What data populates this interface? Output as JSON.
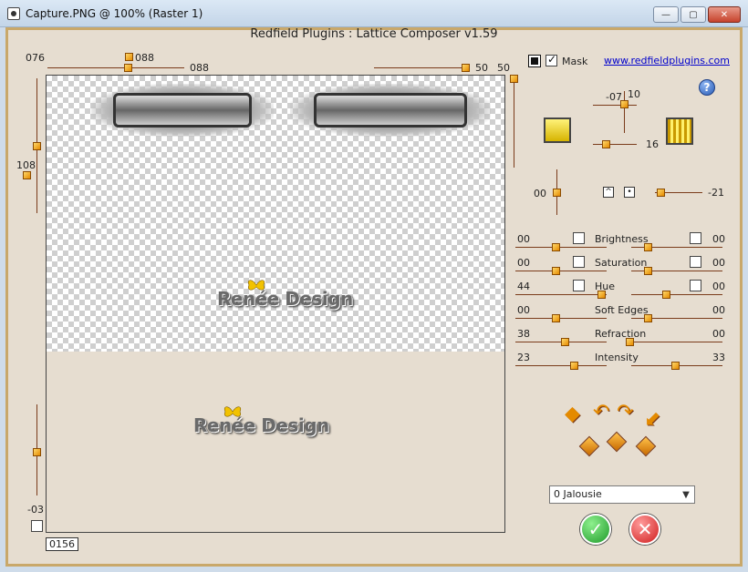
{
  "window": {
    "title": "Capture.PNG @ 100% (Raster 1)"
  },
  "plugin": {
    "title": "Redfield Plugins : Lattice Composer v1.59",
    "link": "www.redfieldplugins.com"
  },
  "top_sliders": {
    "left_value_a": "076",
    "left_value_b": "088",
    "left_value_c": "088",
    "right_value_a": "50",
    "right_value_b": "50"
  },
  "left_sliders": {
    "upper_value": "108",
    "lower_value": "-03",
    "frame_value": "0156"
  },
  "mask": {
    "label": "Mask",
    "checked": true
  },
  "offsets": {
    "a": "-07",
    "b": "10",
    "c": "16",
    "d": "00",
    "e": "-21"
  },
  "adjustments": [
    {
      "label": "Brightness",
      "left_value": "00",
      "right_value": "00",
      "left_level": 0.2,
      "right_level": 0.2
    },
    {
      "label": "Saturation",
      "left_value": "00",
      "right_value": "00",
      "left_level": 0.2,
      "right_level": 0.2
    },
    {
      "label": "Hue",
      "left_value": "44",
      "right_value": "00",
      "left_level": 0.7,
      "right_level": 0.4
    },
    {
      "label": "Soft Edges",
      "left_value": "00",
      "right_value": "00",
      "left_level": 0.2,
      "right_level": 0.2
    },
    {
      "label": "Refraction",
      "left_value": "38",
      "right_value": "00",
      "left_level": 0.3,
      "right_level": 0.0
    },
    {
      "label": "Intensity",
      "left_value": "23",
      "right_value": "33",
      "left_level": 0.4,
      "right_level": 0.5
    }
  ],
  "preview": {
    "logo_text": "Renée Design"
  },
  "select": {
    "value": "0 Jalousie"
  },
  "colors": {
    "accent": "#e48a00",
    "panel": "#e6ddd0",
    "border": "#c9a86a"
  }
}
